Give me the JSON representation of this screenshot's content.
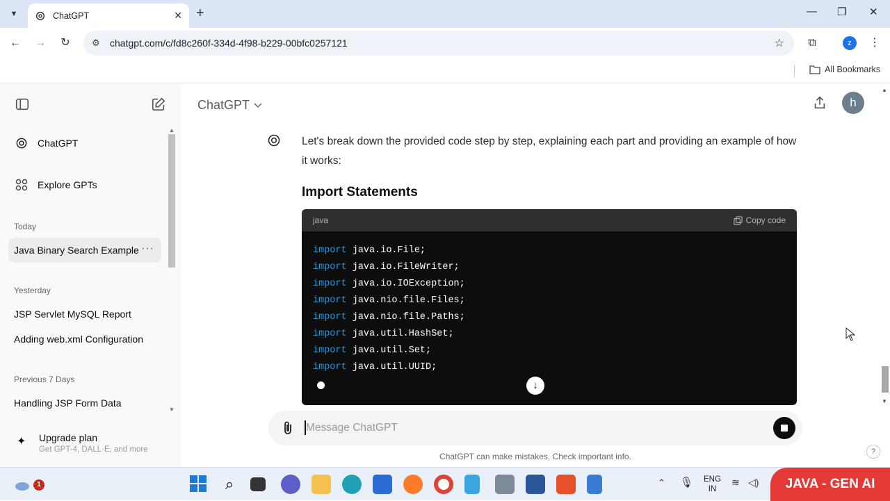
{
  "browser": {
    "tab_title": "ChatGPT",
    "url": "chatgpt.com/c/fd8c260f-334d-4f98-b229-00bfc0257121",
    "bookmarks_label": "All Bookmarks",
    "profile_initial": "z"
  },
  "sidebar": {
    "items": [
      {
        "label": "ChatGPT"
      },
      {
        "label": "Explore GPTs"
      }
    ],
    "sections": [
      {
        "heading": "Today",
        "chats": [
          "Java Binary Search Example"
        ]
      },
      {
        "heading": "Yesterday",
        "chats": [
          "JSP Servlet MySQL Report",
          "Adding web.xml Configuration"
        ]
      },
      {
        "heading": "Previous 7 Days",
        "chats": [
          "Handling JSP Form Data"
        ]
      }
    ],
    "upgrade": {
      "title": "Upgrade plan",
      "subtitle": "Get GPT-4, DALL·E, and more"
    }
  },
  "header": {
    "model": "ChatGPT",
    "avatar_initial": "h"
  },
  "message": {
    "text": "Let's break down the provided code step by step, explaining each part and providing an example of how it works:",
    "heading": "Import Statements",
    "code": {
      "language": "java",
      "copy_label": "Copy code",
      "keyword": "import",
      "lines": [
        "java.io.File;",
        "java.io.FileWriter;",
        "java.io.IOException;",
        "java.nio.file.Files;",
        "java.nio.file.Paths;",
        "java.util.HashSet;",
        "java.util.Set;",
        "java.util.UUID;"
      ]
    }
  },
  "composer": {
    "placeholder": "Message ChatGPT",
    "disclaimer": "ChatGPT can make mistakes. Check important info.",
    "help": "?"
  },
  "taskbar": {
    "notification_count": "1",
    "lang_line1": "ENG",
    "lang_line2": "IN",
    "brand": "JAVA - GEN AI"
  },
  "colors": {
    "keyword": "#2e95d3",
    "brand_red": "#e53935"
  }
}
